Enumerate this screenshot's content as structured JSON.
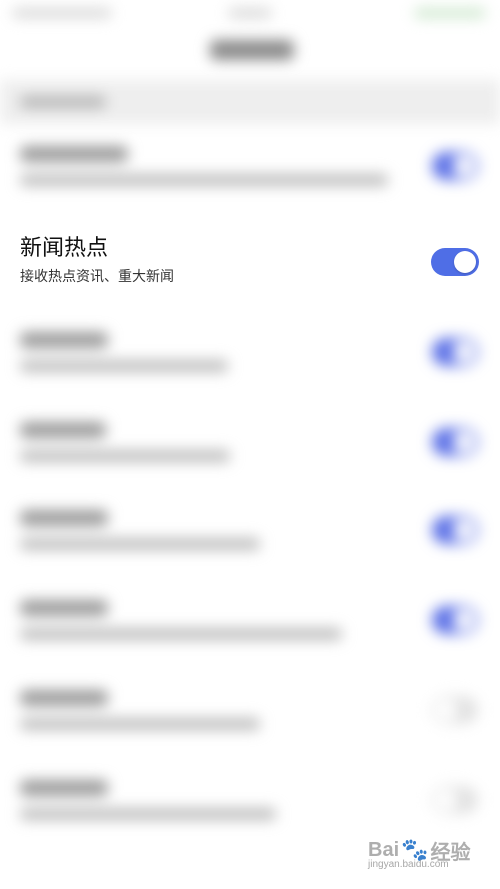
{
  "focused_setting": {
    "title": "新闻热点",
    "subtitle": "接收热点资讯、重大新闻",
    "toggle_on": true
  },
  "colors": {
    "toggle_on": "#4f6ee6",
    "toggle_off": "#e2e2e2"
  },
  "watermark": {
    "brand": "Bai",
    "brand2": "经验",
    "url": "jingyan.baidu.com"
  }
}
